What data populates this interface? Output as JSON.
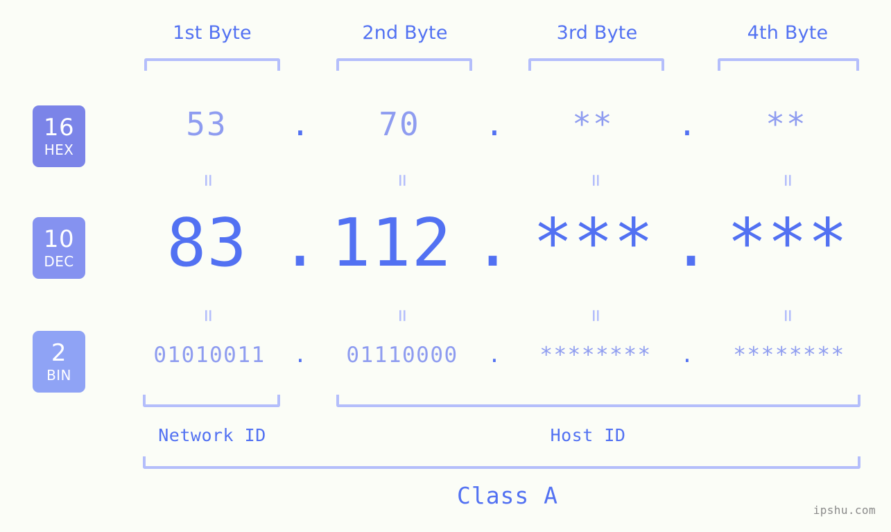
{
  "watermark": "ipshu.com",
  "byte_headers": [
    {
      "label": "1st Byte"
    },
    {
      "label": "2nd Byte"
    },
    {
      "label": "3rd Byte"
    },
    {
      "label": "4th Byte"
    }
  ],
  "badges": [
    {
      "radix": "16",
      "name": "HEX",
      "color": "#7b84e8"
    },
    {
      "radix": "10",
      "name": "DEC",
      "color": "#8592f0"
    },
    {
      "radix": "2",
      "name": "BIN",
      "color": "#8fa3f5"
    }
  ],
  "rows": {
    "hex": {
      "values": [
        "53",
        "70",
        "**",
        "**"
      ]
    },
    "dec": {
      "values": [
        "83",
        "112",
        "***",
        "***"
      ]
    },
    "bin": {
      "values": [
        "01010011",
        "01110000",
        "********",
        "********"
      ]
    }
  },
  "separator": ".",
  "equals_mark": "=",
  "regions": [
    {
      "label": "Network ID"
    },
    {
      "label": "Host ID"
    }
  ],
  "class": {
    "label": "Class A"
  },
  "colors": {
    "background": "#fbfdf7",
    "accent_strong": "#5271f2",
    "accent_mid": "#8e9cf0",
    "accent_light": "#b4befb",
    "watermark": "#8a8a8a"
  }
}
